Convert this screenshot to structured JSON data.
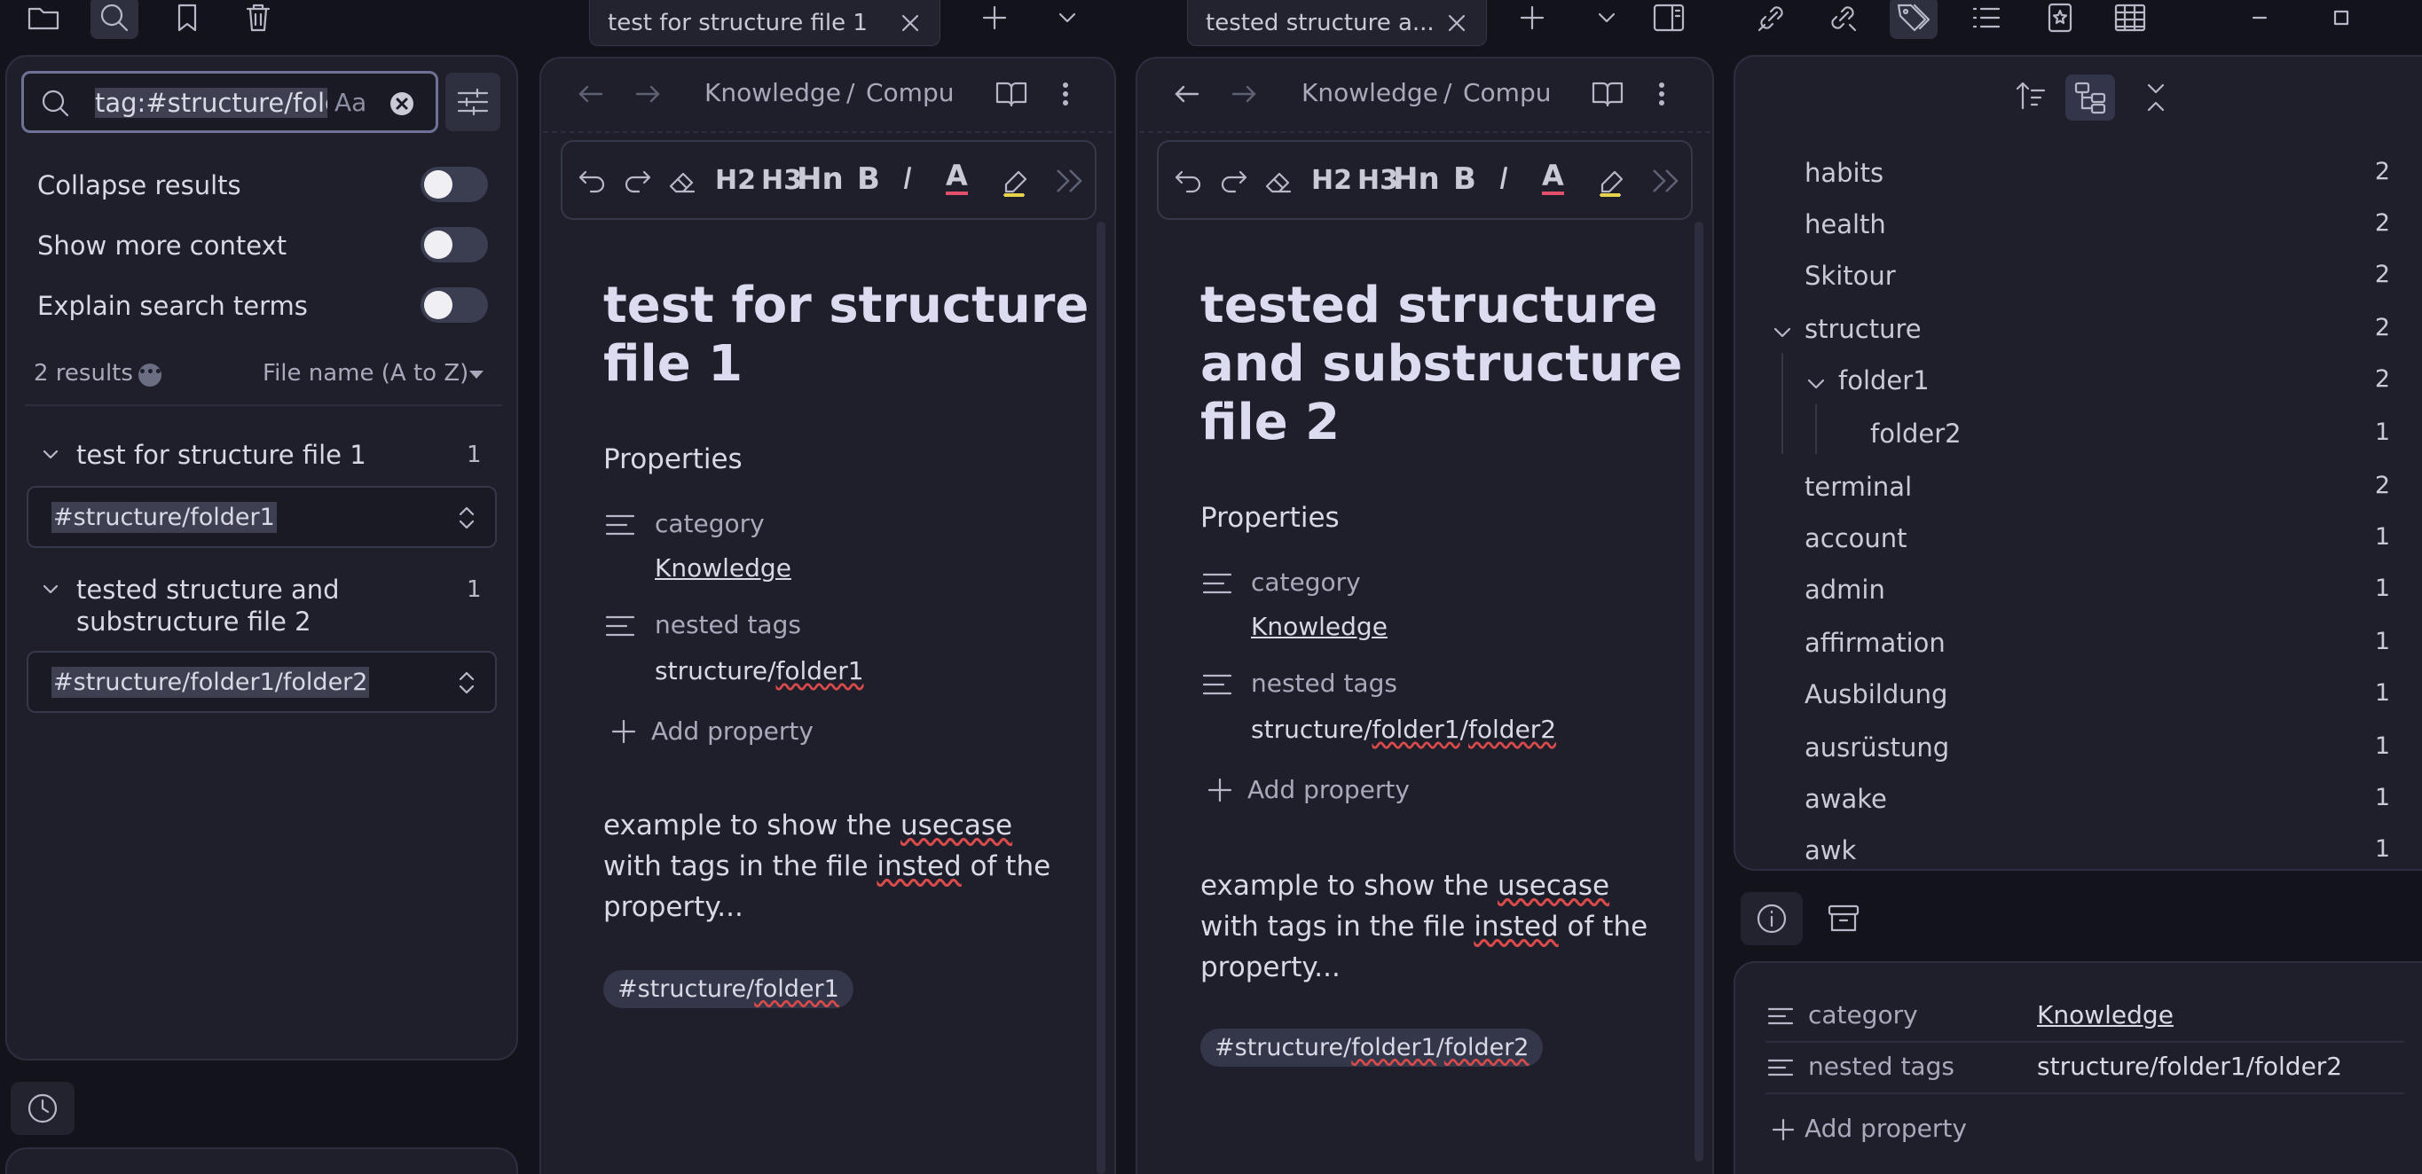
{
  "tabs": [
    {
      "title": "test for structure file 1"
    },
    {
      "title": "tested structure a..."
    }
  ],
  "search": {
    "query": "tag:#structure/folde",
    "match_case": "Aa",
    "options": [
      {
        "label": "Collapse results"
      },
      {
        "label": "Show more context"
      },
      {
        "label": "Explain search terms"
      }
    ],
    "results_count": "2 results",
    "sort": "File name (A to Z)",
    "results": [
      {
        "title": "test for structure file 1",
        "count": "1",
        "match": "#structure/folder1"
      },
      {
        "title_line1": "tested structure and",
        "title_line2": "substructure file 2",
        "count": "1",
        "match": "#structure/folder1/folder2"
      }
    ]
  },
  "pane1": {
    "breadcrumb_1": "Knowledge",
    "breadcrumb_sep": "/",
    "breadcrumb_2": "Compu",
    "title_line1": "test for structure",
    "title_line2": "file 1",
    "properties_label": "Properties",
    "category_key": "category",
    "category_value": "Knowledge",
    "nested_key": "nested tags",
    "nested_value_a": "structure/",
    "nested_value_b": "folder1",
    "add_property": "Add property",
    "body_line1_a": "example to show the ",
    "body_line1_b": "usecase",
    "body_line2_a": "with tags in the file ",
    "body_line2_b": "insted",
    "body_line2_c": " of the",
    "body_line3": "property...",
    "tag_a": "#structure/",
    "tag_b": "folder1"
  },
  "pane2": {
    "breadcrumb_1": "Knowledge",
    "breadcrumb_sep": "/",
    "breadcrumb_2": "Compu",
    "title_line1": "tested structure",
    "title_line2": "and substructure",
    "title_line3": "file 2",
    "properties_label": "Properties",
    "category_key": "category",
    "category_value": "Knowledge",
    "nested_key": "nested tags",
    "nested_value_a": "structure/",
    "nested_value_b": "folder1",
    "nested_value_c": "/",
    "nested_value_d": "folder2",
    "add_property": "Add property",
    "body_line1_a": "example to show the ",
    "body_line1_b": "usecase",
    "body_line2_a": "with tags in the file ",
    "body_line2_b": "insted",
    "body_line2_c": " of the",
    "body_line3": "property...",
    "tag_a": "#structure/",
    "tag_b": "folder1",
    "tag_c": "/",
    "tag_d": "folder2"
  },
  "toolbar": {
    "h2": "H2",
    "h3": "H3",
    "hn": "Hn",
    "bold": "B",
    "italic": "I",
    "color": "A"
  },
  "tags": [
    {
      "name": "habits",
      "count": "2"
    },
    {
      "name": "health",
      "count": "2"
    },
    {
      "name": "Skitour",
      "count": "2"
    },
    {
      "name": "structure",
      "count": "2"
    },
    {
      "name": "folder1",
      "count": "2"
    },
    {
      "name": "folder2",
      "count": "1"
    },
    {
      "name": "terminal",
      "count": "2"
    },
    {
      "name": "account",
      "count": "1"
    },
    {
      "name": "admin",
      "count": "1"
    },
    {
      "name": "affirmation",
      "count": "1"
    },
    {
      "name": "Ausbildung",
      "count": "1"
    },
    {
      "name": "ausrüstung",
      "count": "1"
    },
    {
      "name": "awake",
      "count": "1"
    },
    {
      "name": "awk",
      "count": "1"
    }
  ],
  "side_props": {
    "category_key": "category",
    "category_value": "Knowledge",
    "nested_key": "nested tags",
    "nested_value": "structure/folder1/folder2",
    "add_property": "Add property"
  },
  "colors": {
    "accent": "#bfc3ff",
    "background": "#1f1f2c",
    "spell_error": "#d94a4a"
  }
}
